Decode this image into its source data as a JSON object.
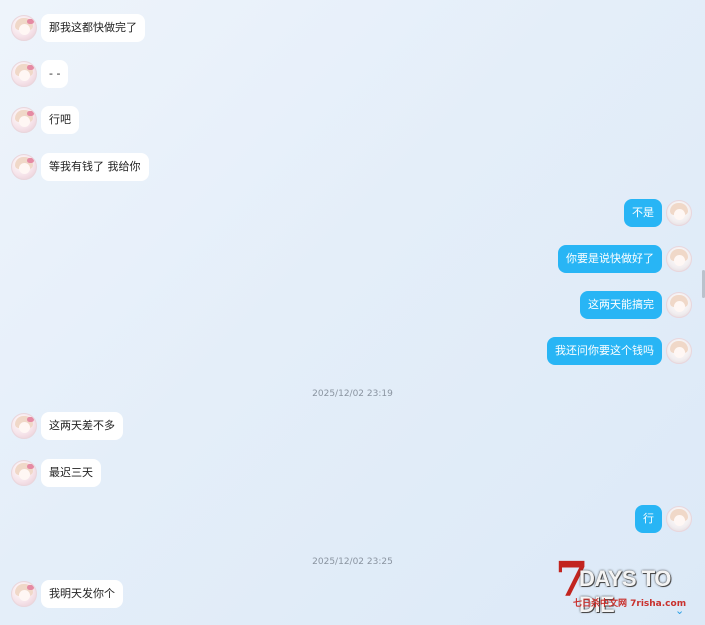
{
  "messages": [
    {
      "side": "left",
      "text": "那我这都快做完了"
    },
    {
      "side": "left",
      "text": "- -"
    },
    {
      "side": "left",
      "text": "行吧"
    },
    {
      "side": "left",
      "text": "等我有钱了 我给你"
    },
    {
      "side": "right",
      "text": "不是"
    },
    {
      "side": "right",
      "text": "你要是说快做好了"
    },
    {
      "side": "right",
      "text": "这两天能搞完"
    },
    {
      "side": "right",
      "text": "我还问你要这个钱吗"
    },
    {
      "side": "left",
      "text": "这两天差不多"
    },
    {
      "side": "left",
      "text": "最迟三天"
    },
    {
      "side": "right",
      "text": "行"
    },
    {
      "side": "left",
      "text": "我明天发你个"
    }
  ],
  "timestamps": [
    "2025/12/02 23:19",
    "2025/12/02 23:25"
  ],
  "watermark": {
    "title": "DAYS TO DIE",
    "number": "7",
    "subtitle": "七日杀中文网 7risha.com"
  },
  "icons": {
    "avatar": "avatar-icon",
    "scroll_down": "chevron-down-icon"
  },
  "colors": {
    "outgoing_bubble": "#28b5f5",
    "incoming_bubble": "#ffffff",
    "logo_red": "#c2241f"
  }
}
